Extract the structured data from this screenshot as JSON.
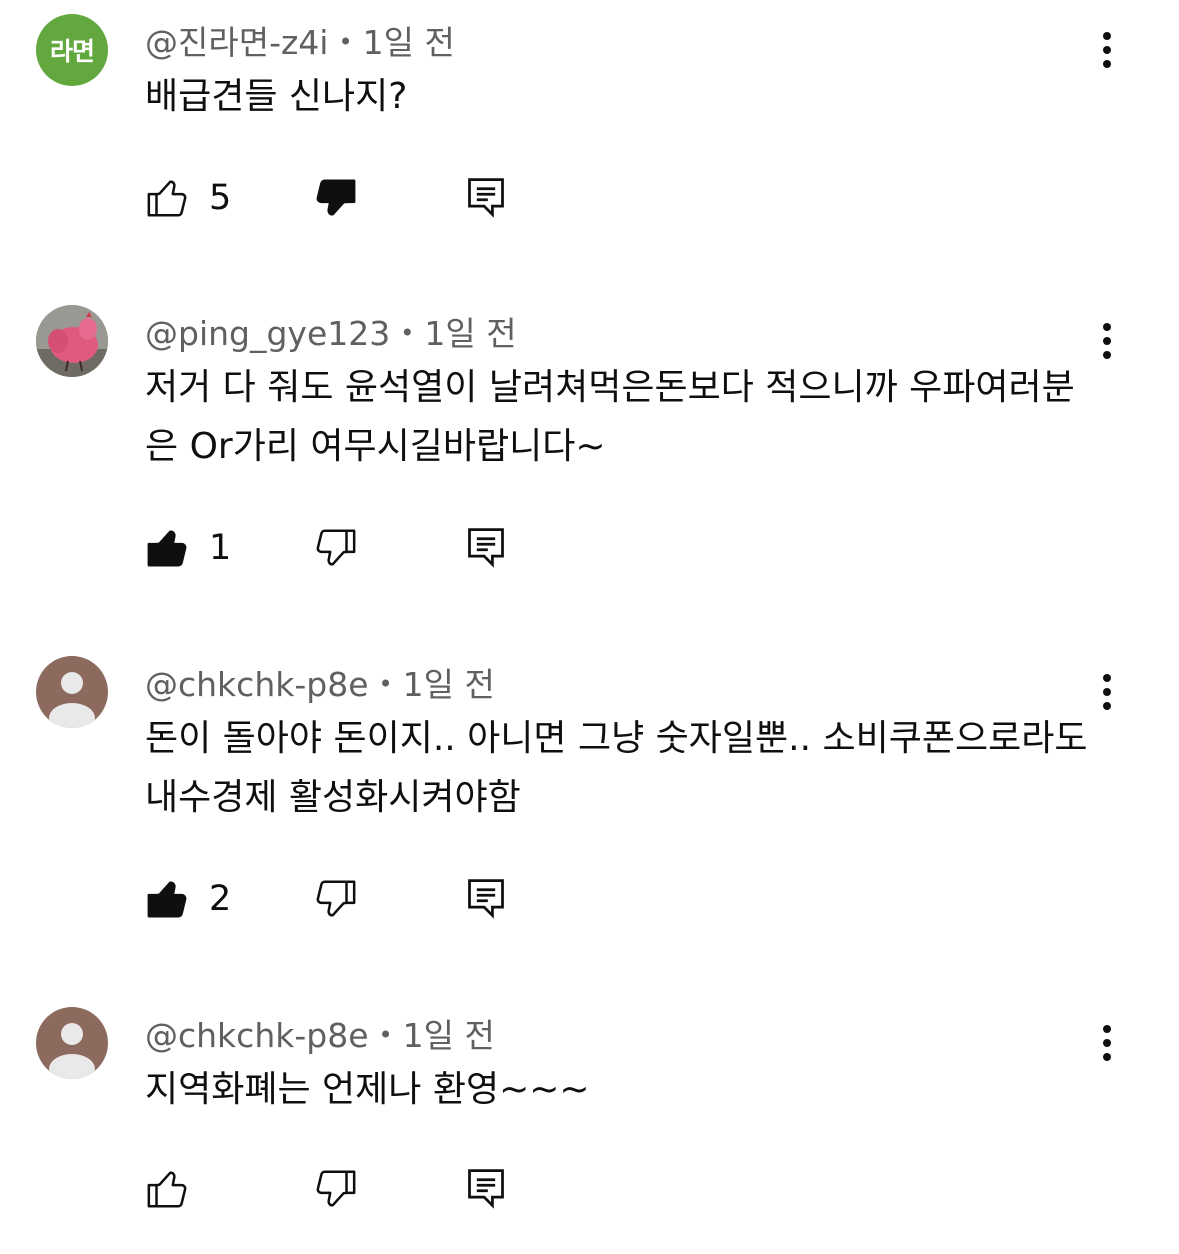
{
  "comments": [
    {
      "avatar": {
        "type": "initials",
        "text": "라면",
        "color": "#62a83f"
      },
      "author": "@진라면-z4i",
      "time": "1일 전",
      "text": "배급견들 신나지?",
      "likes": "5",
      "liked": false,
      "disliked": true
    },
    {
      "avatar": {
        "type": "photo",
        "description": "pink-chicken-photo"
      },
      "author": "@ping_gye123",
      "time": "1일 전",
      "text": "저거 다 줘도 윤석열이 날려쳐먹은돈보다 적으니까 우파여러분은 Or가리 여무시길바랍니다~",
      "likes": "1",
      "liked": true,
      "disliked": false
    },
    {
      "avatar": {
        "type": "default",
        "color": "#8c6a5e"
      },
      "author": "@chkchk-p8e",
      "time": "1일 전",
      "text": "돈이 돌아야 돈이지.. 아니면 그냥 숫자일뿐.. 소비쿠폰으로라도 내수경제 활성화시켜야함",
      "likes": "2",
      "liked": true,
      "disliked": false
    },
    {
      "avatar": {
        "type": "default",
        "color": "#8c6a5e"
      },
      "author": "@chkchk-p8e",
      "time": "1일 전",
      "text": "지역화폐는 언제나 환영~~~",
      "likes": "",
      "liked": false,
      "disliked": false
    }
  ],
  "separator": "•",
  "icons": {
    "like": "thumbs-up-icon",
    "dislike": "thumbs-down-icon",
    "reply": "reply-comment-icon",
    "more": "more-vertical-icon"
  }
}
